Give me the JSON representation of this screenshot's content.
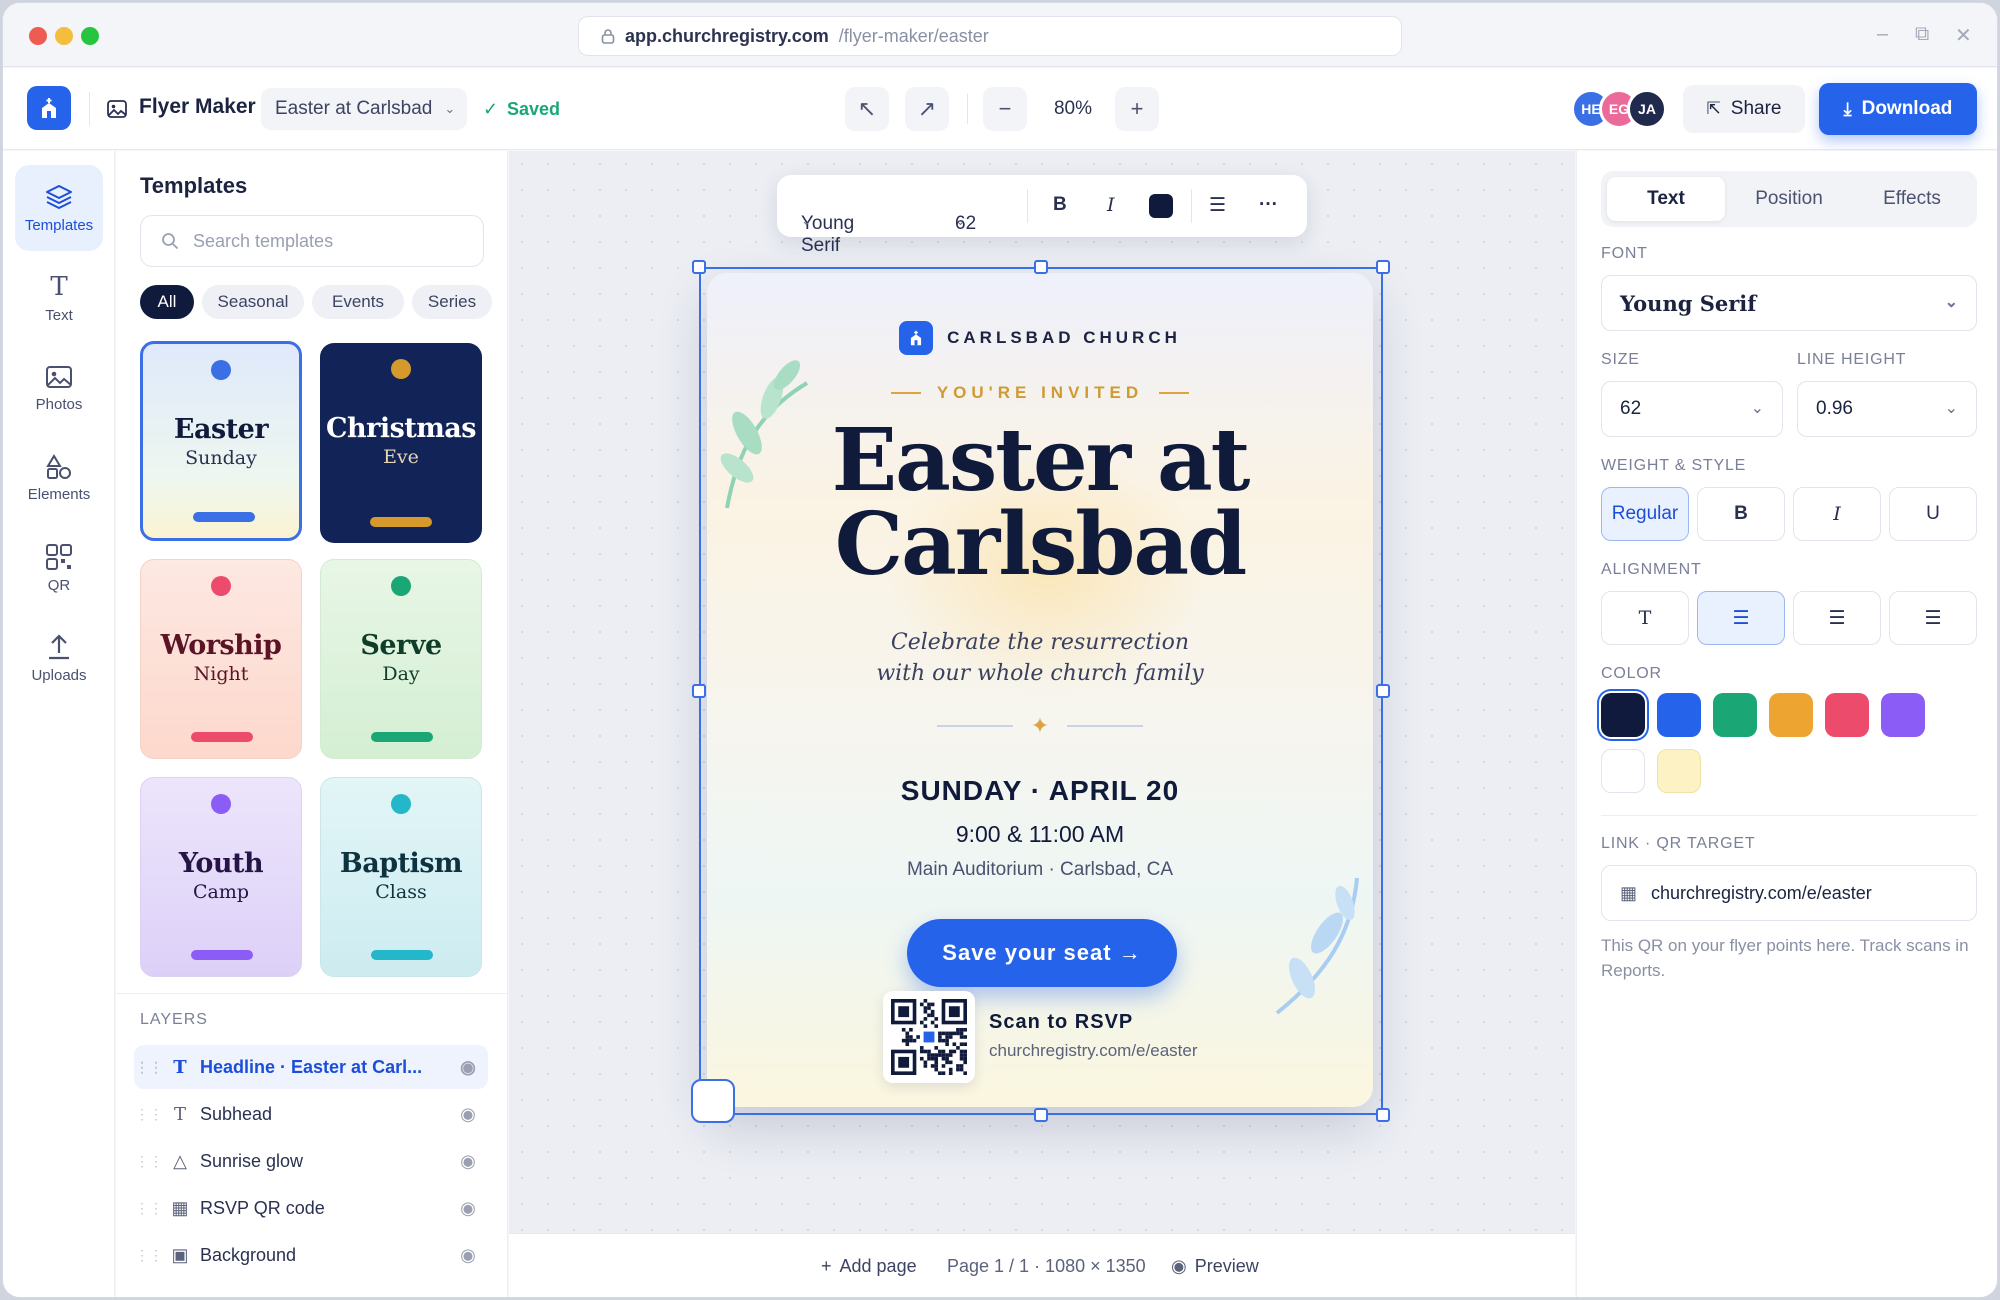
{
  "browser": {
    "host": "app.churchregistry.com",
    "path": "/flyer-maker/easter"
  },
  "header": {
    "app_name": "Flyer Maker",
    "document_name": "Easter at Carlsbad",
    "saved_status": "Saved",
    "zoom": "80%",
    "collaborators": [
      {
        "initials": "HE",
        "color": "#3b6fe6"
      },
      {
        "initials": "EG",
        "color": "#ec6a9a"
      },
      {
        "initials": "JA",
        "color": "#1f2a4d"
      }
    ],
    "share_label": "Share",
    "download_label": "Download"
  },
  "rail": {
    "items": [
      {
        "label": "Templates",
        "icon": "layers-icon",
        "active": true
      },
      {
        "label": "Text",
        "icon": "text-icon"
      },
      {
        "label": "Photos",
        "icon": "image-icon"
      },
      {
        "label": "Elements",
        "icon": "shapes-icon"
      },
      {
        "label": "QR",
        "icon": "qr-icon"
      },
      {
        "label": "Uploads",
        "icon": "upload-icon"
      }
    ]
  },
  "templates": {
    "title": "Templates",
    "search_placeholder": "Search templates",
    "filters": [
      "All",
      "Seasonal",
      "Events",
      "Series"
    ],
    "cards": [
      {
        "title": "Easter",
        "subtitle": "Sunday"
      },
      {
        "title": "Christmas",
        "subtitle": "Eve"
      },
      {
        "title": "Worship",
        "subtitle": "Night"
      },
      {
        "title": "Serve",
        "subtitle": "Day"
      },
      {
        "title": "Youth",
        "subtitle": "Camp"
      },
      {
        "title": "Baptism",
        "subtitle": "Class"
      }
    ]
  },
  "layers": {
    "title": "LAYERS",
    "items": [
      {
        "name": "Headline · Easter at Carl...",
        "icon": "text-icon"
      },
      {
        "name": "Subhead",
        "icon": "text-icon"
      },
      {
        "name": "Sunrise glow",
        "icon": "shapes-icon"
      },
      {
        "name": "RSVP QR code",
        "icon": "qr-icon"
      },
      {
        "name": "Background",
        "icon": "image-icon"
      }
    ]
  },
  "format_toolbar": {
    "font": "Young Serif",
    "size": "62",
    "bold": "B",
    "italic": "I"
  },
  "flyer": {
    "org": "CARLSBAD CHURCH",
    "kicker": "YOU'RE INVITED",
    "headline_line1": "Easter at",
    "headline_line2": "Carlsbad",
    "sub_line1": "Celebrate the resurrection",
    "sub_line2": "with our whole church family",
    "date": "SUNDAY · APRIL 20",
    "times": "9:00 & 11:00 AM",
    "location": "Main Auditorium · Carlsbad, CA",
    "cta": "Save your seat →",
    "qr_title": "Scan to RSVP",
    "qr_url": "churchregistry.com/e/easter"
  },
  "bottom": {
    "add_page": "Add page",
    "page_info": "Page 1 / 1 · 1080 × 1350",
    "preview": "Preview"
  },
  "properties": {
    "tabs": [
      "Text",
      "Position",
      "Effects"
    ],
    "font_label": "FONT",
    "font_value": "Young Serif",
    "size_label": "SIZE",
    "size_value": "62",
    "line_height_label": "LINE HEIGHT",
    "line_height_value": "0.96",
    "weight_label": "WEIGHT & STYLE",
    "weight_options": [
      "Regular",
      "B",
      "I",
      "U"
    ],
    "alignment_label": "ALIGNMENT",
    "color_label": "COLOR",
    "colors": [
      "#0f1a3d",
      "#2563eb",
      "#1aa775",
      "#eda431",
      "#ec4b6b",
      "#8b5cf6",
      "#ffffff",
      "#fdf2c4"
    ],
    "link_label": "LINK · QR TARGET",
    "link_value": "churchregistry.com/e/easter",
    "link_help": "This QR on your flyer points here. Track scans in Reports."
  }
}
